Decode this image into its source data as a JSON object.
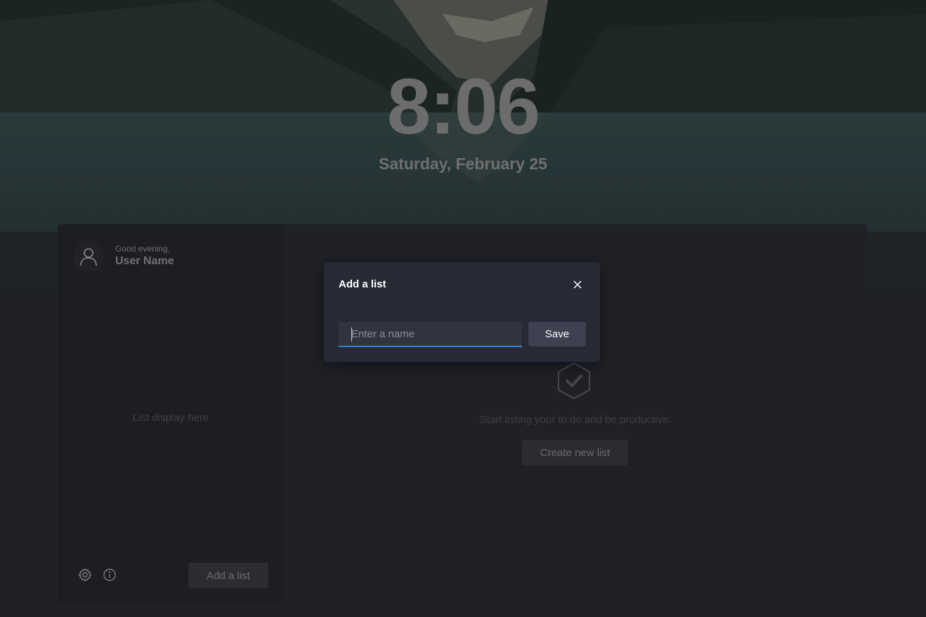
{
  "lockscreen": {
    "time": "8:06",
    "date": "Saturday, February 25"
  },
  "sidebar": {
    "greeting": "Good evening,",
    "user_name": "User Name",
    "list_placeholder": "List display here",
    "add_list_label": "Add a list",
    "icons": {
      "avatar": "person-icon",
      "settings": "gear-icon",
      "info": "info-icon"
    }
  },
  "main": {
    "empty_text": "Start listing your to do and be productive.",
    "create_label": "Create new list",
    "icon": "checkmark-hexagon-icon"
  },
  "dialog": {
    "title": "Add a list",
    "input_value": "",
    "input_placeholder": "Enter a name",
    "save_label": "Save",
    "close_icon": "close-icon"
  },
  "colors": {
    "accent": "#2f7fd8",
    "dialog_bg": "#272a35",
    "panel_bg": "#1f2127"
  }
}
